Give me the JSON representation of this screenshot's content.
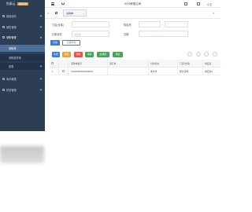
{
  "app": {
    "logo_text": "怡泰云",
    "logo_badge": "运营平台",
    "window_title": "XXX有限公司",
    "user_label": "小王"
  },
  "sidebar": {
    "items": [
      {
        "label": "基础资料"
      },
      {
        "label": "销售管理"
      },
      {
        "label": "采购管理"
      },
      {
        "label": "库存管理"
      },
      {
        "label": "财务管理"
      }
    ],
    "sub_items": [
      {
        "label": "采购单"
      },
      {
        "label": "采购退货单"
      },
      {
        "label": "报表"
      }
    ]
  },
  "tabs": {
    "active": "采购单",
    "close_glyph": "×",
    "left_arrow": "«",
    "right_arrow": "»"
  },
  "search": {
    "store_label": "门店(仓库)",
    "supplier_label": "供应商",
    "status_label": "付款状态",
    "status_placeholder": "请选择",
    "date_label": "日期",
    "date_dash": "-",
    "query_button": "查询",
    "advanced_button": "高级查询"
  },
  "toolbar": {
    "buttons": [
      {
        "label": "新增",
        "color": "#3a7bd5"
      },
      {
        "label": "修改",
        "color": "#e8a33a"
      },
      {
        "label": "删除",
        "color": "#e5534b"
      },
      {
        "label": "审核",
        "color": "#4aa35a"
      },
      {
        "label": "反审核",
        "color": "#4aa35a"
      },
      {
        "label": "导出",
        "color": "#4aa35a"
      }
    ]
  },
  "table": {
    "headers": [
      "采购单编号",
      "源订单",
      "付款状态",
      "门店(仓库)",
      "供应商"
    ],
    "rows": [
      {
        "index": "1",
        "cells": [
          "CGHK0001100000001",
          "",
          "未付款",
          "默认仓库",
          "供应商1"
        ]
      }
    ]
  },
  "colors": {
    "sidebar_bg": "#2c3d54",
    "sidebar_active": "#4d6f9e",
    "primary": "#3a7bd5"
  }
}
